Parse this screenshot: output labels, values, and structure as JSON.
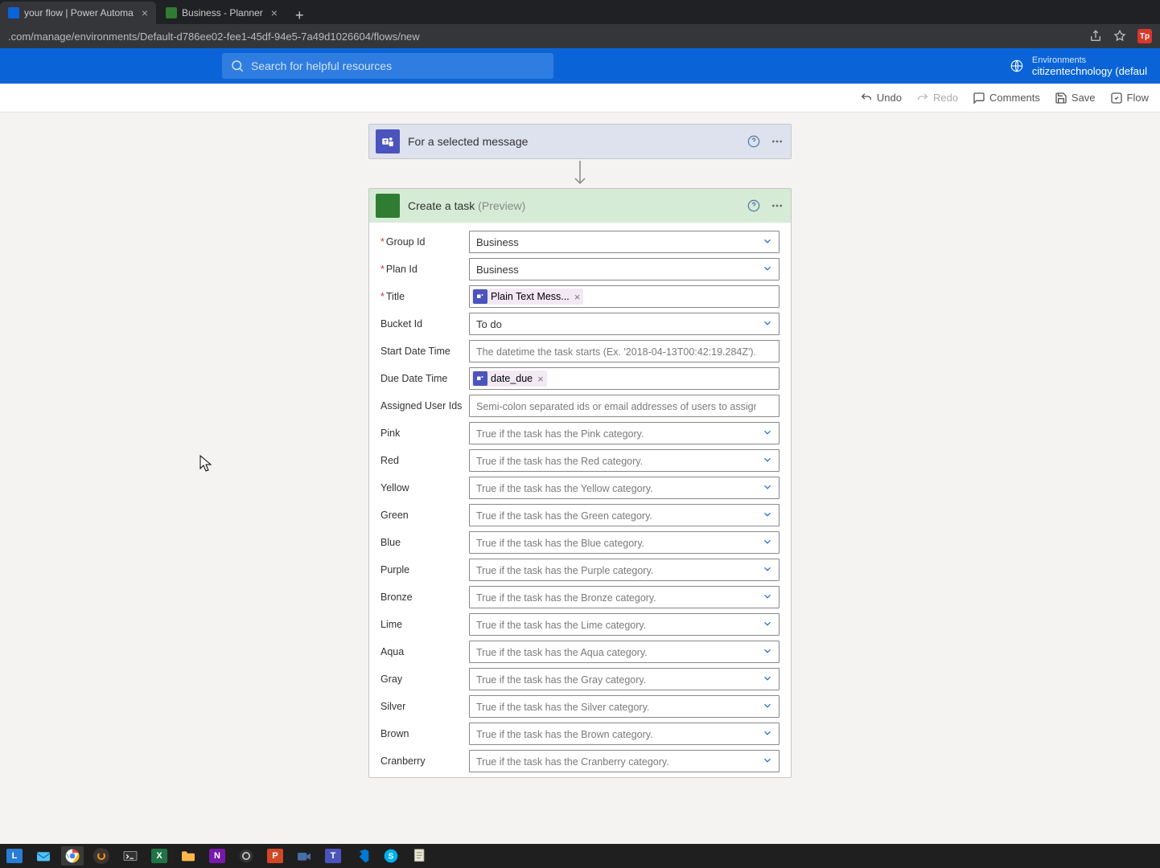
{
  "browser": {
    "tabs": [
      {
        "title": "your flow | Power Automa",
        "favicon_color": "#0a64d8"
      },
      {
        "title": "Business - Planner",
        "favicon_color": "#2e7d32"
      }
    ],
    "url": ".com/manage/environments/Default-d786ee02-fee1-45df-94e5-7a49d1026604/flows/new"
  },
  "topbar": {
    "search_placeholder": "Search for helpful resources",
    "env_label": "Environments",
    "env_name": "citizentechnology (defaul"
  },
  "toolbar": {
    "undo": "Undo",
    "redo": "Redo",
    "comments": "Comments",
    "save": "Save",
    "flow": "Flow"
  },
  "trigger": {
    "title": "For a selected message"
  },
  "action": {
    "title": "Create a task ",
    "suffix": "(Preview)",
    "fields": {
      "group_id": {
        "label": "Group Id",
        "required": true,
        "value": "Business"
      },
      "plan_id": {
        "label": "Plan Id",
        "required": true,
        "value": "Business"
      },
      "title": {
        "label": "Title",
        "required": true,
        "token": "Plain Text Mess..."
      },
      "bucket_id": {
        "label": "Bucket Id",
        "required": false,
        "value": "To do"
      },
      "start_dt": {
        "label": "Start Date Time",
        "required": false,
        "placeholder": "The datetime the task starts (Ex. '2018-04-13T00:42:19.284Z')."
      },
      "due_dt": {
        "label": "Due Date Time",
        "required": false,
        "token": "date_due"
      },
      "assigned": {
        "label": "Assigned User Ids",
        "required": false,
        "placeholder": "Semi-colon separated ids or email addresses of users to assign this task to."
      }
    },
    "categories": [
      {
        "label": "Pink",
        "placeholder": "True if the task has the Pink category."
      },
      {
        "label": "Red",
        "placeholder": "True if the task has the Red category."
      },
      {
        "label": "Yellow",
        "placeholder": "True if the task has the Yellow category."
      },
      {
        "label": "Green",
        "placeholder": "True if the task has the Green category."
      },
      {
        "label": "Blue",
        "placeholder": "True if the task has the Blue category."
      },
      {
        "label": "Purple",
        "placeholder": "True if the task has the Purple category."
      },
      {
        "label": "Bronze",
        "placeholder": "True if the task has the Bronze category."
      },
      {
        "label": "Lime",
        "placeholder": "True if the task has the Lime category."
      },
      {
        "label": "Aqua",
        "placeholder": "True if the task has the Aqua category."
      },
      {
        "label": "Gray",
        "placeholder": "True if the task has the Gray category."
      },
      {
        "label": "Silver",
        "placeholder": "True if the task has the Silver category."
      },
      {
        "label": "Brown",
        "placeholder": "True if the task has the Brown category."
      },
      {
        "label": "Cranberry",
        "placeholder": "True if the task has the Cranberry category."
      }
    ]
  }
}
